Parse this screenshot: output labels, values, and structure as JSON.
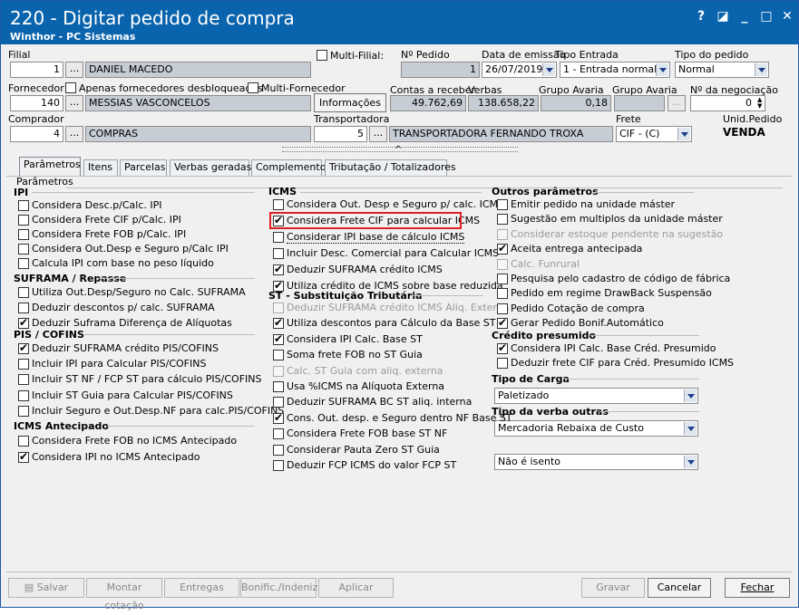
{
  "window": {
    "title": "220 - Digitar pedido de compra",
    "subtitle": "Winthor - PC Sistemas",
    "controls": [
      "?",
      "◪",
      "_",
      "□",
      "✕"
    ]
  },
  "header": {
    "filial_label": "Filial",
    "filial_code": "1",
    "filial_name": "DANIEL MACEDO",
    "multi_filial": "Multi-Filial:",
    "num_pedido_label": "Nº Pedido",
    "num_pedido": "1",
    "data_emissao_label": "Data de emissão",
    "data_emissao": "26/07/2019",
    "tipo_entrada_label": "Tipo Entrada",
    "tipo_entrada": "1 - Entrada normal",
    "tipo_pedido_label": "Tipo do pedido",
    "tipo_pedido": "Normal",
    "fornecedor_label": "Fornecedor",
    "apenas_desbloq": "Apenas fornecedores desbloqueados",
    "multi_fornecedor": "Multi-Fornecedor",
    "fornecedor_code": "140",
    "fornecedor_name": "MESSIAS VASCONCELOS",
    "informacoes": "Informações",
    "contas_label": "Contas a receber",
    "verbas_label": "Verbas",
    "contas": "49.762,69",
    "verbas": "138.658,22",
    "grupo_avaria1_label": "Grupo Avaria",
    "grupo_avaria1": "0,18",
    "grupo_avaria2_label": "Grupo Avaria",
    "negociacao_label": "Nº da negociação",
    "negociacao": "0",
    "comprador_label": "Comprador",
    "comprador_code": "4",
    "comprador_name": "COMPRAS",
    "transportadora_label": "Transportadora",
    "transportadora_code": "5",
    "transportadora_name": "TRANSPORTADORA FERNANDO TROXA",
    "frete_label": "Frete",
    "frete": "CIF - (C)",
    "unid_pedido_label": "Unid.Pedido",
    "unid_pedido": "VENDA",
    "dots": "...",
    "collapse": "^"
  },
  "tabs": [
    "Parâmetros",
    "Itens",
    "Parcelas",
    "Verbas geradas",
    "Complemento",
    "Tributação / Totalizadores"
  ],
  "panel_title": "Parâmetros",
  "col1": {
    "ipi_title": "IPI",
    "ipi": [
      "Considera Desc.p/Calc. IPI",
      "Considera Frete CIF p/Calc. IPI",
      "Considera Frete FOB p/Calc. IPI",
      "Considera Out.Desp e Seguro p/Calc IPI",
      "Calcula IPI com base no peso líquido"
    ],
    "suframa_title": "SUFRAMA / Repasse",
    "suframa": [
      "Utiliza Out.Desp/Seguro no Calc. SUFRAMA",
      "Deduzir descontos p/ calc. SUFRAMA",
      "Deduzir Suframa Diferença de Alíquotas"
    ],
    "pis_title": "PIS / COFINS",
    "pis": [
      "Deduzir SUFRAMA crédito PIS/COFINS",
      "Incluir IPI para Calcular PIS/COFINS",
      "Incluir ST NF / FCP ST para cálculo PIS/COFINS",
      "Incluir ST Guia para Calcular PIS/COFINS",
      "Incluir Seguro e Out.Desp.NF para calc.PIS/COFINS"
    ],
    "icms_ant_title": "ICMS Antecipado",
    "icms_ant": [
      "Considera Frete FOB no ICMS Antecipado",
      "Considera IPI no ICMS Antecipado"
    ]
  },
  "col2": {
    "icms_title": "ICMS",
    "icms": [
      "Considera Out. Desp e Seguro p/ calc. ICMS",
      "Considera Frete CIF para calcular ICMS",
      "Considerar IPI base de cálculo ICMS",
      "Incluir Desc. Comercial  para Calcular ICMS",
      "Deduzir SUFRAMA crédito ICMS",
      "Utiliza crédito de ICMS sobre base reduzida"
    ],
    "st_title": "ST - Substituição Tributária",
    "st": [
      "Deduzir SUFRAMA crédito ICMS Aliq. Externa",
      "Utiliza descontos para Cálculo da Base ST",
      "Considera IPI Calc. Base ST",
      "Soma frete FOB no ST Guia",
      "Calc. ST Guia com aliq. externa",
      "Usa %ICMS na Alíquota Externa",
      "Deduzir SUFRAMA BC ST aliq. interna",
      "Cons. Out. desp. e Seguro dentro NF Base ST",
      "Considera Frete FOB base ST NF",
      "Considerar Pauta Zero ST Guia",
      "Deduzir FCP ICMS do valor FCP ST"
    ]
  },
  "col3": {
    "outros_title": "Outros parâmetros",
    "outros": [
      "Emitir pedido na unidade máster",
      "Sugestão em multiplos da unidade máster",
      "Considerar estoque pendente na sugestão",
      "Aceita entrega antecipada",
      "Calc. Funrural",
      "Pesquisa pelo cadastro de código de fábrica",
      "Pedido em regime DrawBack Suspensão",
      "Pedido Cotação de compra",
      "Gerar Pedido Bonif.Automático"
    ],
    "credito_title": "Crédito presumido",
    "credito": [
      "Considera IPI Calc. Base Créd. Presumido",
      "Deduzir frete CIF para Créd. Presumido ICMS"
    ],
    "tipo_carga_title": "Tipo de Carga",
    "tipo_carga": "Paletizado",
    "tipo_verba_title": "Tipo da verba outras",
    "tipo_verba": "Mercadoria Rebaixa de Custo",
    "isento": "Não é isento"
  },
  "footer": {
    "salvar": "Salvar",
    "montar": "Montar cotação",
    "entregas": "Entregas",
    "bonific": "Bonific./Indeniz.",
    "aplicar": "Aplicar",
    "gravar": "Gravar",
    "cancelar": "Cancelar",
    "fechar": "Fechar"
  },
  "colors": {
    "titlebar": "#0a64ad",
    "highlight": "#e02020"
  }
}
